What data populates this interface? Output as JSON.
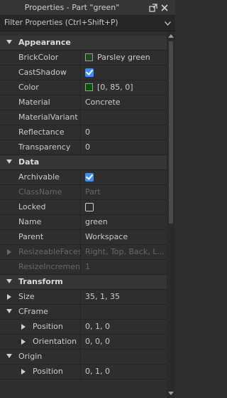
{
  "window": {
    "title": "Properties - Part \"green\"",
    "filter_placeholder": "Filter Properties (Ctrl+Shift+P)"
  },
  "categories": {
    "appearance": "Appearance",
    "data": "Data",
    "transform": "Transform"
  },
  "appearance": {
    "brickcolor": {
      "name": "BrickColor",
      "value": "Parsley green",
      "swatch": "#1f4a1c"
    },
    "castshadow": {
      "name": "CastShadow",
      "checked": true
    },
    "color": {
      "name": "Color",
      "value": "[0, 85, 0]",
      "swatch": "#005500"
    },
    "material": {
      "name": "Material",
      "value": "Concrete"
    },
    "materialvariant": {
      "name": "MaterialVariant",
      "value": ""
    },
    "reflectance": {
      "name": "Reflectance",
      "value": "0"
    },
    "transparency": {
      "name": "Transparency",
      "value": "0"
    }
  },
  "data": {
    "archivable": {
      "name": "Archivable",
      "checked": true
    },
    "classname": {
      "name": "ClassName",
      "value": "Part"
    },
    "locked": {
      "name": "Locked",
      "checked": false
    },
    "name": {
      "name": "Name",
      "value": "green"
    },
    "parent": {
      "name": "Parent",
      "value": "Workspace"
    },
    "resizeablefaces": {
      "name": "ResizeableFaces",
      "value": "Right, Top, Back, L..."
    },
    "resizeincrement": {
      "name": "ResizeIncrement",
      "value": "1"
    }
  },
  "transform": {
    "size": {
      "name": "Size",
      "value": "35, 1, 35"
    },
    "cframe": {
      "name": "CFrame",
      "value": ""
    },
    "cframe_position": {
      "name": "Position",
      "value": "0, 1, 0"
    },
    "cframe_orientation": {
      "name": "Orientation",
      "value": "0, 0, 0"
    },
    "origin": {
      "name": "Origin",
      "value": ""
    },
    "origin_position": {
      "name": "Position",
      "value": "0, 1, 0"
    }
  },
  "colors": {
    "accent": "#3a8fff",
    "background": "#2e2e2e",
    "category_bg": "#353535"
  }
}
